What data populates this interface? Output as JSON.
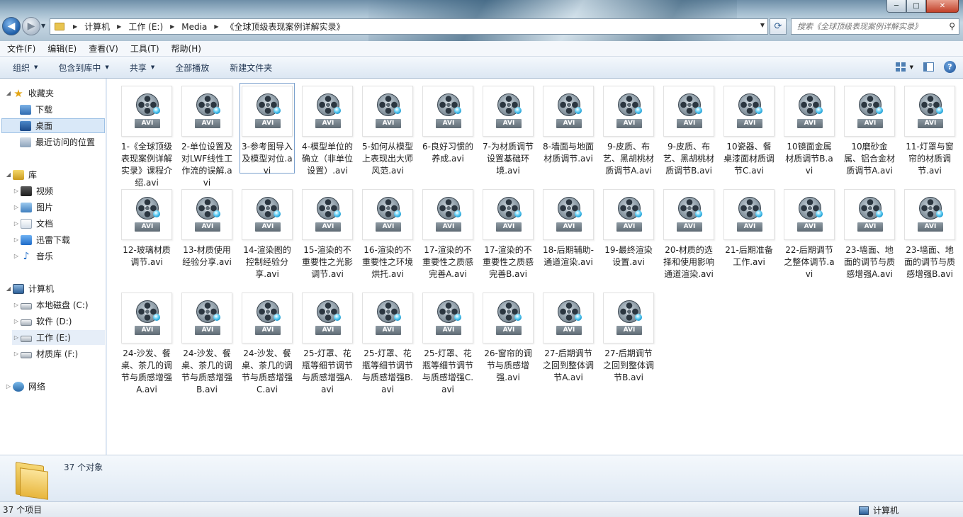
{
  "window": {
    "minimize_label": "─",
    "maximize_label": "□",
    "close_label": "✕"
  },
  "address": {
    "crumbs": [
      "计算机",
      "工作 (E:)",
      "Media",
      "《全球顶级表现案例详解实录》"
    ]
  },
  "search": {
    "placeholder": "搜索《全球顶级表现案例详解实录》"
  },
  "menu": [
    "文件(F)",
    "编辑(E)",
    "查看(V)",
    "工具(T)",
    "帮助(H)"
  ],
  "commands": [
    "组织",
    "包含到库中",
    "共享",
    "全部播放",
    "新建文件夹"
  ],
  "nav": {
    "favorites": "收藏夹",
    "downloads": "下载",
    "desktop": "桌面",
    "recent": "最近访问的位置",
    "libraries": "库",
    "videos": "视频",
    "pictures": "图片",
    "documents": "文档",
    "thunder": "迅雷下载",
    "music": "音乐",
    "computer": "计算机",
    "drive_c": "本地磁盘 (C:)",
    "drive_d": "软件 (D:)",
    "drive_e": "工作 (E:)",
    "drive_f": "材质库 (F:)",
    "network": "网络"
  },
  "file_type_label": "AVI",
  "files": [
    "1-《全球顶级表现案例详解实录》课程介绍.avi",
    "2-单位设置及对LWF线性工作流的误解.avi",
    "3-参考图导入及模型对位.avi",
    "4-模型单位的确立（非单位设置）.avi",
    "5-如何从模型上表现出大师风范.avi",
    "6-良好习惯的养成.avi",
    "7-为材质调节设置基础环境.avi",
    "8-墙面与地面材质调节.avi",
    "9-皮质、布艺、黑胡桃材质调节A.avi",
    "9-皮质、布艺、黑胡桃材质调节B.avi",
    "10瓷器、餐桌漆面材质调节C.avi",
    "10镜面金属材质调节B.avi",
    "10磨砂金属、铝合金材质调节A.avi",
    "11-灯罩与窗帘的材质调节.avi",
    "12-玻璃材质调节.avi",
    "13-材质使用经验分享.avi",
    "14-渲染图的控制经验分享.avi",
    "15-渲染的不重要性之光影调节.avi",
    "16-渲染的不重要性之环境烘托.avi",
    "17-渲染的不重要性之质感完善A.avi",
    "17-渲染的不重要性之质感完善B.avi",
    "18-后期辅助-通道渲染.avi",
    "19-最终渲染设置.avi",
    "20-材质的选择和使用影响通道渲染.avi",
    "21-后期准备工作.avi",
    "22-后期调节之整体调节.avi",
    "23-墙面、地面的调节与质感增强A.avi",
    "23-墙面、地面的调节与质感增强B.avi",
    "24-沙发、餐桌、茶几的调节与质感增强A.avi",
    "24-沙发、餐桌、茶几的调节与质感增强B.avi",
    "24-沙发、餐桌、茶几的调节与质感增强C.avi",
    "25-灯罩、花瓶等细节调节与质感增强A.avi",
    "25-灯罩、花瓶等细节调节与质感增强B.avi",
    "25-灯罩、花瓶等细节调节与质感增强C.avi",
    "26-窗帘的调节与质感增强.avi",
    "27-后期调节之回到整体调节A.avi",
    "27-后期调节之回到整体调节B.avi"
  ],
  "details": {
    "count": "37 个对象"
  },
  "status": {
    "items": "37 个项目",
    "location": "计算机"
  }
}
